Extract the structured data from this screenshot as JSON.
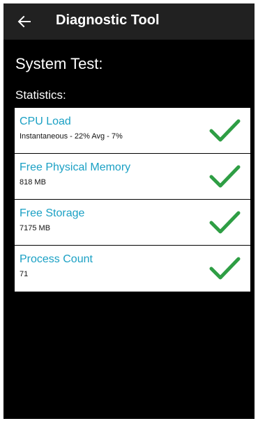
{
  "appbar": {
    "title": "Diagnostic Tool",
    "back_icon": "arrow-left-icon"
  },
  "page": {
    "heading": "System Test:",
    "subheading": "Statistics:"
  },
  "stats": [
    {
      "label": "CPU Load",
      "value": "Instantaneous - 22%  Avg - 7%",
      "status_icon": "checkmark-icon"
    },
    {
      "label": "Free Physical Memory",
      "value": "818 MB",
      "status_icon": "checkmark-icon"
    },
    {
      "label": "Free Storage",
      "value": "7175 MB",
      "status_icon": "checkmark-icon"
    },
    {
      "label": "Process Count",
      "value": "71",
      "status_icon": "checkmark-icon"
    }
  ],
  "colors": {
    "appbar_bg": "#212121",
    "background": "#000000",
    "accent": "#1aa0c4",
    "check": "#2e9e44"
  }
}
